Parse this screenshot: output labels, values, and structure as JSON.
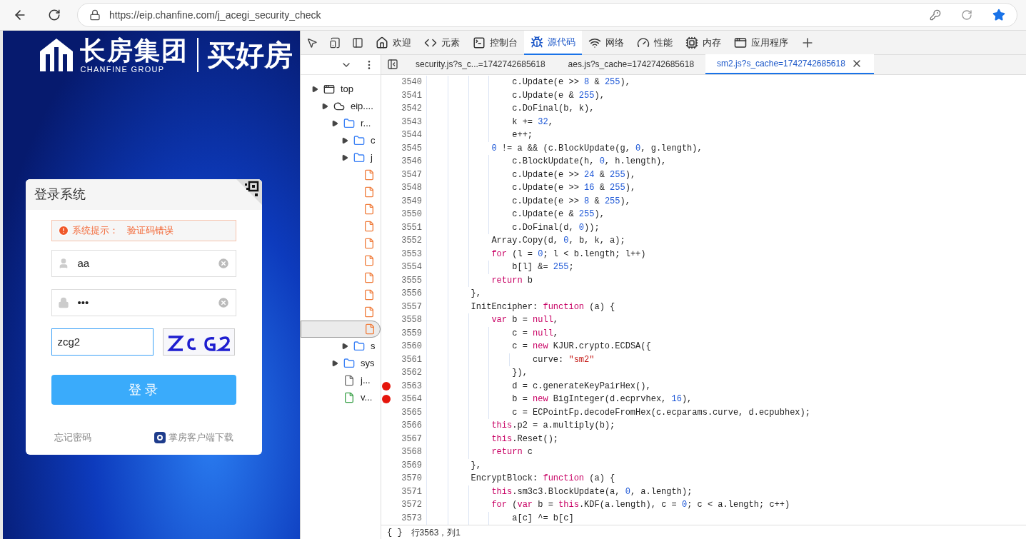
{
  "browser": {
    "url": "https://eip.chanfine.com/j_acegi_security_check"
  },
  "page": {
    "logo": {
      "name": "长房集团",
      "subtitle": "CHANFINE GROUP",
      "slogan": "买好房"
    },
    "login": {
      "title": "登录系统",
      "alert_label": "系统提示：",
      "alert_message": "验证码错误",
      "username": "aa",
      "password": "•••",
      "captcha": "zcg2",
      "submit": "登 录",
      "forgot": "忘记密码",
      "download": "掌房客户端下载"
    }
  },
  "devtools": {
    "tabs": [
      {
        "label": "欢迎",
        "selected": false
      },
      {
        "label": "元素",
        "selected": false
      },
      {
        "label": "控制台",
        "selected": false
      },
      {
        "label": "源代码",
        "selected": true
      },
      {
        "label": "网络",
        "selected": false
      },
      {
        "label": "性能",
        "selected": false
      },
      {
        "label": "内存",
        "selected": false
      },
      {
        "label": "应用程序",
        "selected": false
      }
    ],
    "file_tabs": [
      {
        "label": "security.js?s_c...=1742742685618",
        "selected": false
      },
      {
        "label": "aes.js?s_cache=1742742685618",
        "selected": false
      },
      {
        "label": "sm2.js?s_cache=1742742685618",
        "selected": true
      }
    ],
    "tree": [
      {
        "kind": "frame",
        "label": "top",
        "selected": false,
        "children": [
          {
            "kind": "domain",
            "label": "eip....",
            "selected": false,
            "children": [
              {
                "kind": "folder",
                "label": "r...",
                "selected": false,
                "children": [
                  {
                    "kind": "folder",
                    "label": "c",
                    "selected": false
                  },
                  {
                    "kind": "folder",
                    "label": "j",
                    "selected": false,
                    "children": [
                      {
                        "kind": "file",
                        "color": "#f07d3c",
                        "selected": false
                      },
                      {
                        "kind": "file",
                        "color": "#f07d3c",
                        "selected": false
                      },
                      {
                        "kind": "file",
                        "color": "#f07d3c",
                        "selected": false
                      },
                      {
                        "kind": "file",
                        "color": "#f07d3c",
                        "selected": false
                      },
                      {
                        "kind": "file",
                        "color": "#f07d3c",
                        "selected": false
                      },
                      {
                        "kind": "file",
                        "color": "#f07d3c",
                        "selected": false
                      },
                      {
                        "kind": "file",
                        "color": "#f07d3c",
                        "selected": false
                      },
                      {
                        "kind": "file",
                        "color": "#f07d3c",
                        "selected": false
                      },
                      {
                        "kind": "file",
                        "color": "#f07d3c",
                        "selected": false
                      },
                      {
                        "kind": "file",
                        "color": "#f07d3c",
                        "selected": true
                      }
                    ]
                  },
                  {
                    "kind": "folder",
                    "label": "s",
                    "selected": false
                  }
                ]
              },
              {
                "kind": "folder",
                "label": "sys",
                "selected": false
              },
              {
                "kind": "file",
                "label": "j...",
                "color": "#6b6b6b",
                "selected": false
              },
              {
                "kind": "file",
                "label": "v...",
                "color": "#3fa34d",
                "selected": false
              }
            ]
          }
        ]
      }
    ],
    "code": [
      {
        "number": "3540",
        "text": "                c.Update(e >> 8 & 255),",
        "breakpoint": false
      },
      {
        "number": "3541",
        "text": "                c.Update(e & 255),",
        "breakpoint": false
      },
      {
        "number": "3542",
        "text": "                c.DoFinal(b, k),",
        "breakpoint": false
      },
      {
        "number": "3543",
        "text": "                k += 32,",
        "breakpoint": false
      },
      {
        "number": "3544",
        "text": "                e++;",
        "breakpoint": false
      },
      {
        "number": "3545",
        "text": "            0 != a && (c.BlockUpdate(g, 0, g.length),",
        "breakpoint": false
      },
      {
        "number": "3546",
        "text": "                c.BlockUpdate(h, 0, h.length),",
        "breakpoint": false
      },
      {
        "number": "3547",
        "text": "                c.Update(e >> 24 & 255),",
        "breakpoint": false
      },
      {
        "number": "3548",
        "text": "                c.Update(e >> 16 & 255),",
        "breakpoint": false
      },
      {
        "number": "3549",
        "text": "                c.Update(e >> 8 & 255),",
        "breakpoint": false
      },
      {
        "number": "3550",
        "text": "                c.Update(e & 255),",
        "breakpoint": false
      },
      {
        "number": "3551",
        "text": "                c.DoFinal(d, 0));",
        "breakpoint": false
      },
      {
        "number": "3552",
        "text": "            Array.Copy(d, 0, b, k, a);",
        "breakpoint": false
      },
      {
        "number": "3553",
        "text": "            for (l = 0; l < b.length; l++)",
        "breakpoint": false
      },
      {
        "number": "3554",
        "text": "                b[l] &= 255;",
        "breakpoint": false
      },
      {
        "number": "3555",
        "text": "            return b",
        "breakpoint": false
      },
      {
        "number": "3556",
        "text": "        },",
        "breakpoint": false
      },
      {
        "number": "3557",
        "text": "        InitEncipher: function (a) {",
        "breakpoint": false
      },
      {
        "number": "3558",
        "text": "            var b = null,",
        "breakpoint": false
      },
      {
        "number": "3559",
        "text": "                c = null,",
        "breakpoint": false
      },
      {
        "number": "3560",
        "text": "                c = new KJUR.crypto.ECDSA({",
        "breakpoint": false
      },
      {
        "number": "3561",
        "text": "                    curve: \"sm2\"",
        "breakpoint": false
      },
      {
        "number": "3562",
        "text": "                }),",
        "breakpoint": false
      },
      {
        "number": "3563",
        "text": "                d = c.generateKeyPairHex(),",
        "breakpoint": true
      },
      {
        "number": "3564",
        "text": "                b = new BigInteger(d.ecprvhex, 16),",
        "breakpoint": true
      },
      {
        "number": "3565",
        "text": "                c = ECPointFp.decodeFromHex(c.ecparams.curve, d.ecpubhex);",
        "breakpoint": false
      },
      {
        "number": "3566",
        "text": "            this.p2 = a.multiply(b);",
        "breakpoint": false
      },
      {
        "number": "3567",
        "text": "            this.Reset();",
        "breakpoint": false
      },
      {
        "number": "3568",
        "text": "            return c",
        "breakpoint": false
      },
      {
        "number": "3569",
        "text": "        },",
        "breakpoint": false
      },
      {
        "number": "3570",
        "text": "        EncryptBlock: function (a) {",
        "breakpoint": false
      },
      {
        "number": "3571",
        "text": "            this.sm3c3.BlockUpdate(a, 0, a.length);",
        "breakpoint": false
      },
      {
        "number": "3572",
        "text": "            for (var b = this.KDF(a.length), c = 0; c < a.length; c++)",
        "breakpoint": false
      },
      {
        "number": "3573",
        "text": "                a[c] ^= b[c]",
        "breakpoint": false
      }
    ],
    "status_bar": {
      "braces": "{ }",
      "position": "行3563，列1"
    }
  }
}
